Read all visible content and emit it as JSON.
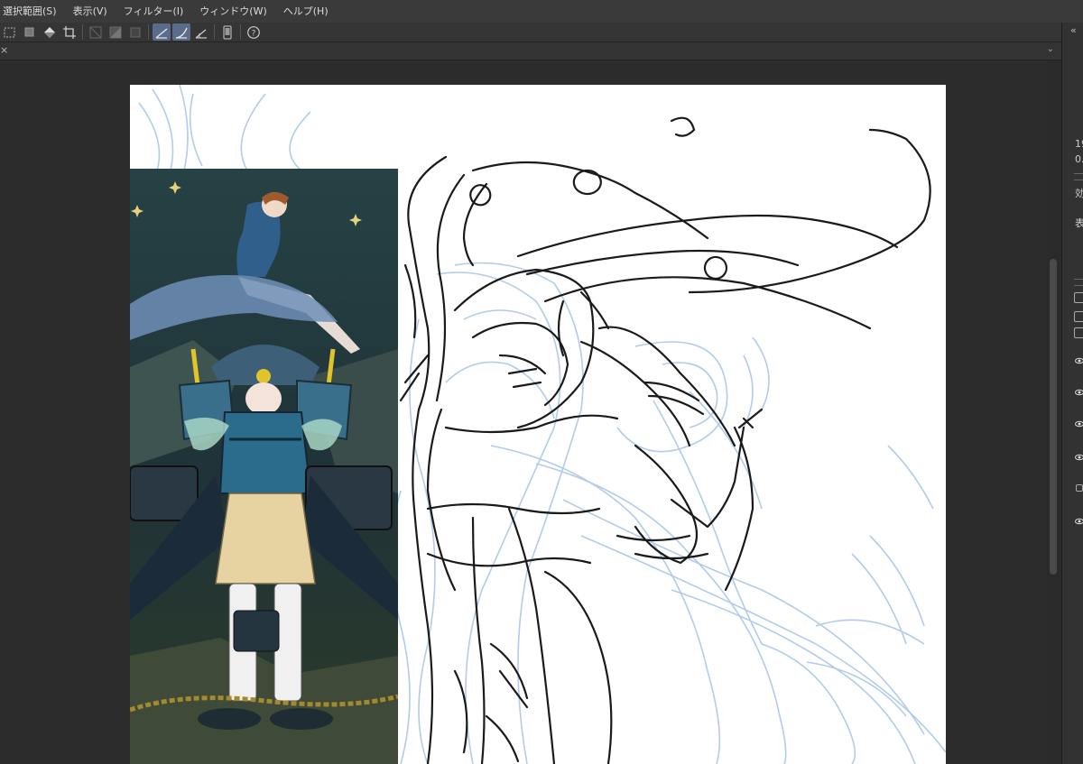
{
  "menu": [
    {
      "label": "選択範囲(S)"
    },
    {
      "label": "表示(V)"
    },
    {
      "label": "フィルター(I)"
    },
    {
      "label": "ウィンドウ(W)"
    },
    {
      "label": "ヘルプ(H)"
    }
  ],
  "toolbar": {
    "buttons": [
      {
        "icon": "deselect-icon",
        "name": "tb-deselect"
      },
      {
        "icon": "selection-layer-icon",
        "name": "tb-selection-layer"
      },
      {
        "icon": "fill-icon",
        "name": "tb-fill"
      },
      {
        "icon": "crop-icon",
        "name": "tb-crop"
      },
      {
        "icon": "grid-off-icon",
        "name": "tb-grid-1"
      },
      {
        "icon": "gradient-icon",
        "name": "tb-grid-2"
      },
      {
        "icon": "square-icon",
        "name": "tb-square"
      },
      {
        "icon": "ruler-snap-icon",
        "name": "tb-ruler-snap",
        "active": true
      },
      {
        "icon": "curve-snap-icon",
        "name": "tb-curve-snap",
        "active": true
      },
      {
        "icon": "angle-ruler-icon",
        "name": "tb-angle-ruler"
      },
      {
        "icon": "tablet-icon",
        "name": "tb-tablet"
      },
      {
        "icon": "help-icon",
        "name": "tb-help"
      }
    ]
  },
  "tabs": {
    "close_symbol": "×",
    "menu_symbol": "⌄"
  },
  "right_panel": {
    "collapse_symbol": "«",
    "value_1": "19",
    "value_2": "0.",
    "label_1": "効",
    "label_2": "表"
  },
  "colors": {
    "menubar": "#3a3a3a",
    "workspace": "#2c2c2c",
    "canvas": "#ffffff",
    "sketch_blue": "#a9c6e8",
    "sketch_ink": "#1a1a1a",
    "active_tool": "#5a6c8a"
  }
}
